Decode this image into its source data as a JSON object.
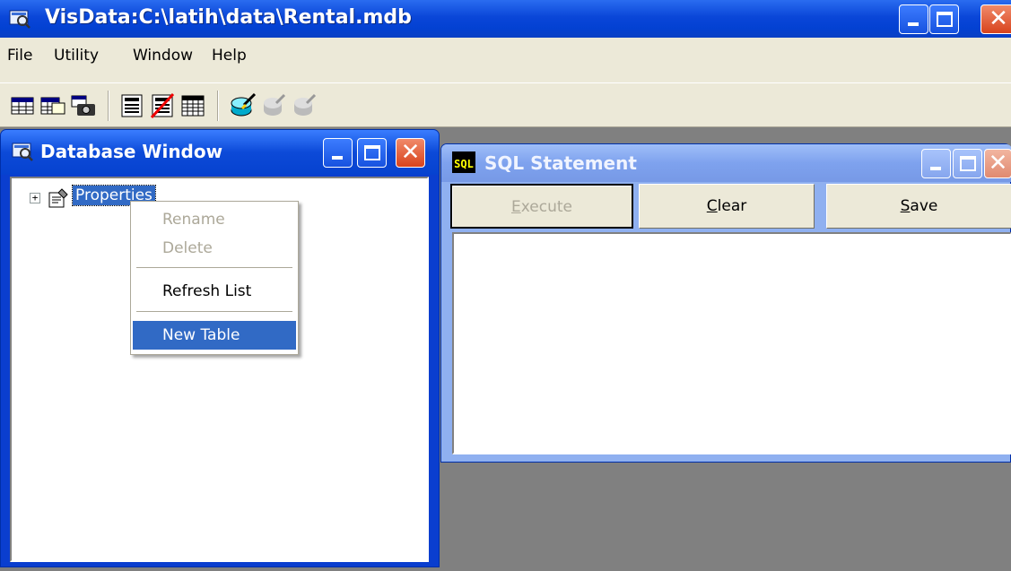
{
  "app": {
    "title": "VisData:C:\\latih\\data\\Rental.mdb",
    "accent": "#0a46d8"
  },
  "menubar": {
    "items": [
      {
        "label": "File"
      },
      {
        "label": "Utility"
      },
      {
        "label": "Window"
      },
      {
        "label": "Help"
      }
    ]
  },
  "toolbar": {
    "icons": [
      "table-type-icon",
      "dynaset-type-icon",
      "snapshot-type-icon",
      "use-data-control-icon",
      "no-data-control-icon",
      "use-dbgrid-icon",
      "begin-transaction-icon",
      "commit-icon",
      "rollback-icon"
    ]
  },
  "database_window": {
    "title": "Database Window",
    "tree": {
      "expander": "+",
      "node_label": "Properties"
    }
  },
  "context_menu": {
    "items": [
      {
        "label": "Rename",
        "enabled": false
      },
      {
        "label": "Delete",
        "enabled": false
      },
      {
        "label": "Refresh List",
        "enabled": true
      },
      {
        "label": "New Table",
        "enabled": true,
        "selected": true
      }
    ]
  },
  "sql_window": {
    "title": "SQL Statement",
    "icon_text": "SQL",
    "buttons": [
      {
        "label": "Execute",
        "accel": "E",
        "rest": "xecute",
        "enabled": false
      },
      {
        "label": "Clear",
        "accel": "C",
        "rest": "lear",
        "enabled": true
      },
      {
        "label": "Save",
        "accel": "S",
        "rest": "ave",
        "enabled": true
      }
    ],
    "statement": ""
  }
}
